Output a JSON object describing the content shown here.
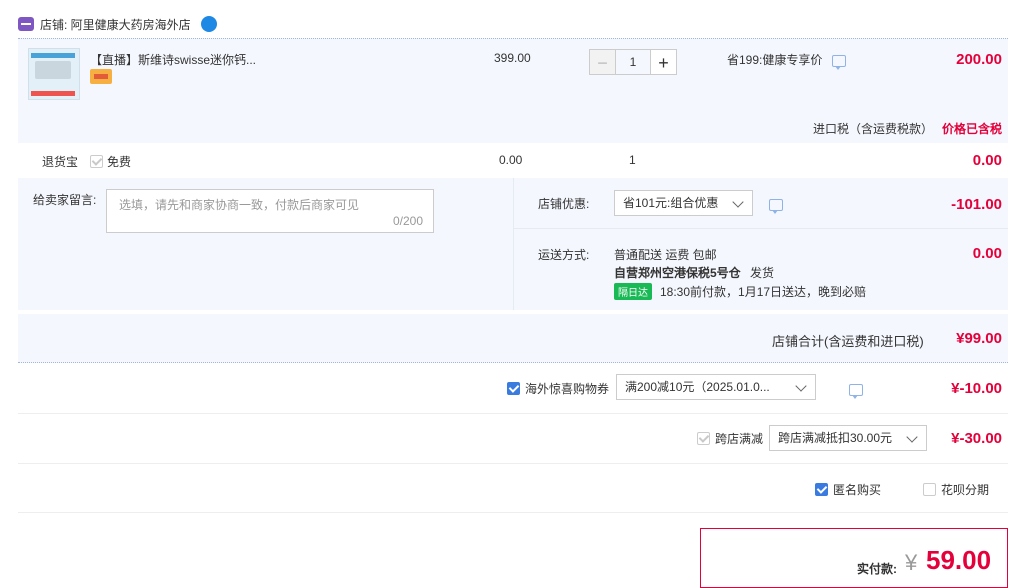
{
  "shop": {
    "label": "店铺: 阿里健康大药房海外店"
  },
  "item": {
    "title": "【直播】斯维诗swisse迷你钙...",
    "price": "399.00",
    "quantity": "1",
    "promo": "省199:健康专享价",
    "total": "200.00",
    "tax_label": "进口税（含运费税款）",
    "tax_status": "价格已含税"
  },
  "return_service": {
    "label": "退货宝",
    "option": "免费",
    "price": "0.00",
    "qty": "1",
    "total": "0.00"
  },
  "note": {
    "label": "给卖家留言:",
    "placeholder": "选填，请先和商家协商一致，付款后商家可见",
    "counter": "0/200"
  },
  "store_discount": {
    "label": "店铺优惠:",
    "selected": "省101元:组合优惠",
    "total": "-101.00"
  },
  "shipping": {
    "label": "运送方式:",
    "method": "普通配送 运费 包邮",
    "warehouse": "自营郑州空港保税5号仓",
    "status": "发货",
    "badge": "隔日达",
    "eta": "18:30前付款，1月17日送达，晚到必赔",
    "total": "0.00"
  },
  "store_sum": {
    "label": "店铺合计(含运费和进口税)",
    "total": "¥99.00"
  },
  "coupon": {
    "label": "海外惊喜购物券",
    "selected": "满200减10元（2025.01.0...",
    "total": "¥-10.00"
  },
  "cross_store": {
    "label": "跨店满减",
    "selected": "跨店满减抵扣30.00元",
    "total": "¥-30.00"
  },
  "anonymous": {
    "label": "匿名购买",
    "checked": true
  },
  "huabei": {
    "label": "花呗分期",
    "checked": false
  },
  "payment": {
    "label": "实付款:",
    "currency": "¥",
    "amount": "59.00"
  },
  "colors": {
    "accent_red": "#e4003a",
    "check_blue": "#3a7be0",
    "panel_bg": "#f4f7fd"
  }
}
